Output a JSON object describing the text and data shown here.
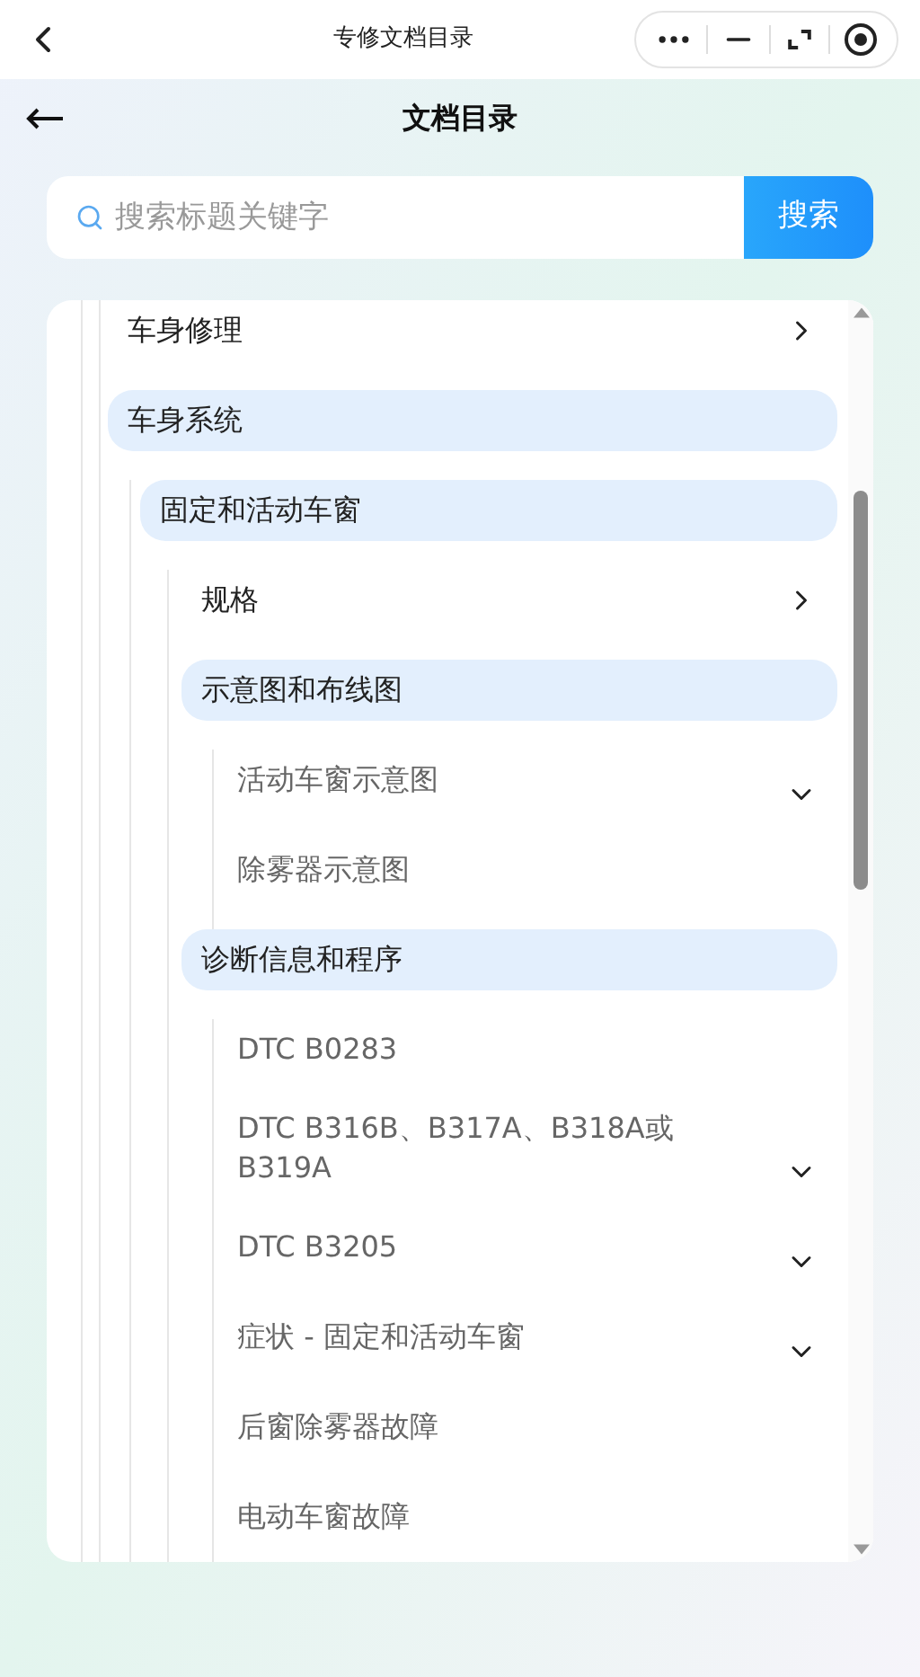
{
  "top_bar": {
    "title": "专修文档目录"
  },
  "header": {
    "title": "文档目录"
  },
  "search": {
    "placeholder": "搜索标题关键字",
    "button": "搜索"
  },
  "tree": [
    {
      "label": "车身修理",
      "kind": "branch",
      "expanded": false
    },
    {
      "label": "车身系统",
      "kind": "branch",
      "expanded": true,
      "children": [
        {
          "label": "固定和活动车窗",
          "kind": "branch",
          "expanded": true,
          "children": [
            {
              "label": "规格",
              "kind": "branch",
              "expanded": false
            },
            {
              "label": "示意图和布线图",
              "kind": "branch",
              "expanded": true,
              "children": [
                {
                  "label": "活动车窗示意图",
                  "kind": "leaf",
                  "expandable": true
                },
                {
                  "label": "除雾器示意图",
                  "kind": "leaf",
                  "expandable": false
                }
              ]
            },
            {
              "label": "诊断信息和程序",
              "kind": "branch",
              "expanded": true,
              "children": [
                {
                  "label": "DTC B0283",
                  "kind": "leaf",
                  "expandable": false
                },
                {
                  "label": "DTC B316B、B317A、B318A或B319A",
                  "kind": "leaf",
                  "expandable": true
                },
                {
                  "label": "DTC B3205",
                  "kind": "leaf",
                  "expandable": true
                },
                {
                  "label": "症状 - 固定和活动车窗",
                  "kind": "leaf",
                  "expandable": true
                },
                {
                  "label": "后窗除雾器故障",
                  "kind": "leaf",
                  "expandable": false
                },
                {
                  "label": "电动车窗故障",
                  "kind": "leaf",
                  "expandable": false
                }
              ]
            }
          ]
        }
      ]
    }
  ]
}
